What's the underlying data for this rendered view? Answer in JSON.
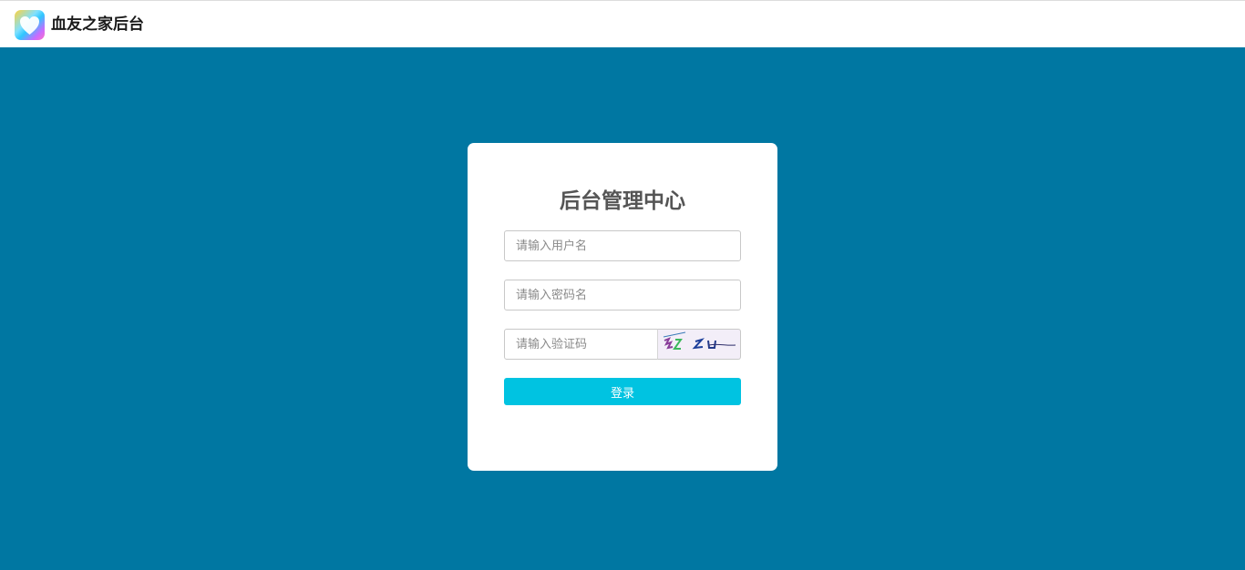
{
  "header": {
    "app_title": "血友之家后台",
    "logo_icon": "heart-icon"
  },
  "login": {
    "title": "后台管理中心",
    "username_placeholder": "请输入用户名",
    "username_value": "",
    "password_placeholder": "请输入密码名",
    "password_value": "",
    "captcha_placeholder": "请输入验证码",
    "captcha_value": "",
    "captcha_text": "3z Z U",
    "submit_label": "登录"
  },
  "colors": {
    "background": "#0077a2",
    "button": "#00c3e1",
    "card": "#ffffff"
  }
}
